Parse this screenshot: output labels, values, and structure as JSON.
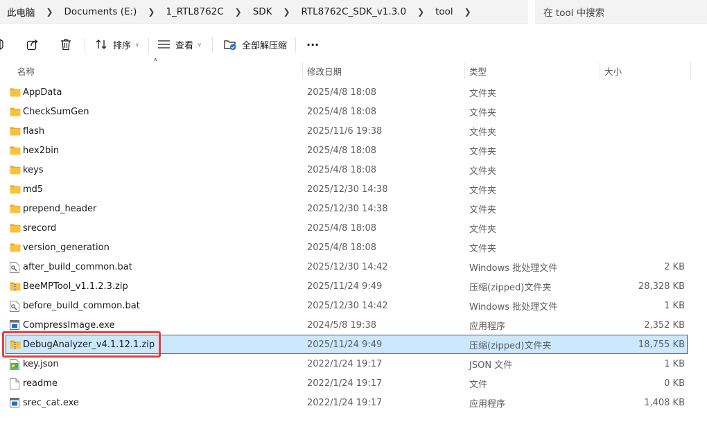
{
  "breadcrumb": [
    "此电脑",
    "Documents (E:)",
    "1_RTL8762C",
    "SDK",
    "RTL8762C_SDK_v1.3.0",
    "tool"
  ],
  "search": {
    "placeholder": "在 tool 中搜索"
  },
  "toolbar": {
    "sort_label": "排序",
    "view_label": "查看",
    "extract_all_label": "全部解压缩",
    "more_label": "···"
  },
  "columns": {
    "name": "名称",
    "date": "修改日期",
    "type": "类型",
    "size": "大小"
  },
  "files": [
    {
      "name": "AppData",
      "date": "2025/4/8 18:08",
      "type": "文件夹",
      "size": "",
      "icon": "folder-icon"
    },
    {
      "name": "CheckSumGen",
      "date": "2025/4/8 18:08",
      "type": "文件夹",
      "size": "",
      "icon": "folder-icon"
    },
    {
      "name": "flash",
      "date": "2025/11/6 19:38",
      "type": "文件夹",
      "size": "",
      "icon": "folder-icon"
    },
    {
      "name": "hex2bin",
      "date": "2025/4/8 18:08",
      "type": "文件夹",
      "size": "",
      "icon": "folder-icon"
    },
    {
      "name": "keys",
      "date": "2025/4/8 18:08",
      "type": "文件夹",
      "size": "",
      "icon": "folder-icon"
    },
    {
      "name": "md5",
      "date": "2025/12/30 14:38",
      "type": "文件夹",
      "size": "",
      "icon": "folder-icon"
    },
    {
      "name": "prepend_header",
      "date": "2025/12/30 14:38",
      "type": "文件夹",
      "size": "",
      "icon": "folder-icon"
    },
    {
      "name": "srecord",
      "date": "2025/4/8 18:08",
      "type": "文件夹",
      "size": "",
      "icon": "folder-icon"
    },
    {
      "name": "version_generation",
      "date": "2025/4/8 18:08",
      "type": "文件夹",
      "size": "",
      "icon": "folder-icon"
    },
    {
      "name": "after_build_common.bat",
      "date": "2025/12/30 14:42",
      "type": "Windows 批处理文件",
      "size": "2 KB",
      "icon": "batch-file-icon"
    },
    {
      "name": "BeeMPTool_v1.1.2.3.zip",
      "date": "2025/11/24 9:49",
      "type": "压缩(zipped)文件夹",
      "size": "28,328 KB",
      "icon": "zip-folder-icon"
    },
    {
      "name": "before_build_common.bat",
      "date": "2025/12/30 14:42",
      "type": "Windows 批处理文件",
      "size": "1 KB",
      "icon": "batch-file-icon"
    },
    {
      "name": "CompressImage.exe",
      "date": "2024/5/8 19:38",
      "type": "应用程序",
      "size": "2,352 KB",
      "icon": "exe-icon"
    },
    {
      "name": "DebugAnalyzer_v4.1.12.1.zip",
      "date": "2025/11/24 9:49",
      "type": "压缩(zipped)文件夹",
      "size": "18,755 KB",
      "icon": "zip-folder-icon",
      "selected": true
    },
    {
      "name": "key.json",
      "date": "2022/1/24 19:17",
      "type": "JSON 文件",
      "size": "1 KB",
      "icon": "json-file-icon"
    },
    {
      "name": "readme",
      "date": "2022/1/24 19:17",
      "type": "文件",
      "size": "0 KB",
      "icon": "blank-file-icon"
    },
    {
      "name": "srec_cat.exe",
      "date": "2022/1/24 19:17",
      "type": "应用程序",
      "size": "1,408 KB",
      "icon": "exe-icon"
    }
  ],
  "colors": {
    "selection_bg": "#cce8ff",
    "highlight_border": "#e53f3f",
    "folder_yellow": "#f8c33c"
  }
}
